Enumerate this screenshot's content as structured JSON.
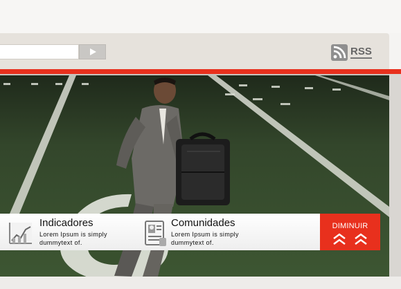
{
  "search": {
    "value": "",
    "button_icon": "play-arrow-icon"
  },
  "rss": {
    "label": "RSS",
    "icon": "rss-feed-icon"
  },
  "features": [
    {
      "title": "Indicadores",
      "text": "Lorem Ipsum is simply dummytext of.",
      "icon": "line-chart-icon"
    },
    {
      "title": "Comunidades",
      "text": "Lorem Ipsum is simply dummytext of.",
      "icon": "document-profile-icon"
    }
  ],
  "collapse": {
    "label": "DIMINUIR",
    "icon": "double-chevron-up-icon"
  },
  "colors": {
    "accent": "#e8301d",
    "toolbar": "#e6e2dc",
    "field": "#3b5530"
  }
}
